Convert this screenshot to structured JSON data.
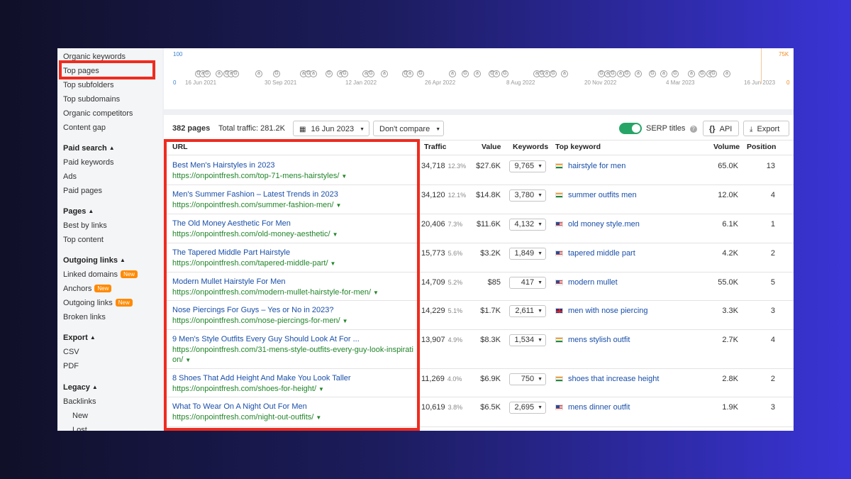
{
  "sidebar": {
    "items": [
      {
        "label": "Organic keywords"
      },
      {
        "label": "Top pages"
      },
      {
        "label": "Top subfolders"
      },
      {
        "label": "Top subdomains"
      },
      {
        "label": "Organic competitors"
      },
      {
        "label": "Content gap"
      }
    ],
    "paid_search": {
      "heading": "Paid search",
      "items": [
        "Paid keywords",
        "Ads",
        "Paid pages"
      ]
    },
    "pages": {
      "heading": "Pages",
      "items": [
        "Best by links",
        "Top content"
      ]
    },
    "outgoing_links": {
      "heading": "Outgoing links",
      "items": [
        "Linked domains",
        "Anchors",
        "Outgoing links",
        "Broken links"
      ],
      "new_badge": "New"
    },
    "export": {
      "heading": "Export",
      "items": [
        "CSV",
        "PDF"
      ]
    },
    "legacy": {
      "heading": "Legacy",
      "items": [
        "Backlinks",
        "New",
        "Lost"
      ]
    }
  },
  "timeline": {
    "left_top": "100",
    "left_bottom": "0",
    "right_top": "75K",
    "right_bottom": "0",
    "dates": [
      "16 Jun 2021",
      "30 Sep 2021",
      "12 Jan 2022",
      "26 Apr 2022",
      "8 Aug 2022",
      "20 Nov 2022",
      "4 Mar 2023",
      "16 Jun 2023"
    ],
    "marker_glyphs": [
      "G",
      "a"
    ]
  },
  "toolbar": {
    "pages_count": "382 pages",
    "total_traffic": "Total traffic: 281.2K",
    "date": "16 Jun 2023",
    "compare": "Don't compare",
    "serp_titles": "SERP titles",
    "api": "API",
    "export": "Export"
  },
  "table": {
    "headers": {
      "url": "URL",
      "traffic": "Traffic",
      "value": "Value",
      "keywords": "Keywords",
      "top_keyword": "Top keyword",
      "volume": "Volume",
      "position": "Position"
    },
    "rows": [
      {
        "title": "Best Men's Hairstyles in 2023",
        "url": "https://onpointfresh.com/top-71-mens-hairstyles/",
        "traffic": "34,718",
        "pct": "12.3%",
        "value": "$27.6K",
        "keywords": "9,765",
        "flag": "in",
        "top_keyword": "hairstyle for men",
        "volume": "65.0K",
        "position": "13"
      },
      {
        "title": "Men's Summer Fashion – Latest Trends in 2023",
        "url": "https://onpointfresh.com/summer-fashion-men/",
        "traffic": "34,120",
        "pct": "12.1%",
        "value": "$14.8K",
        "keywords": "3,780",
        "flag": "in",
        "top_keyword": "summer outfits men",
        "volume": "12.0K",
        "position": "4"
      },
      {
        "title": "The Old Money Aesthetic For Men",
        "url": "https://onpointfresh.com/old-money-aesthetic/",
        "traffic": "20,406",
        "pct": "7.3%",
        "value": "$11.6K",
        "keywords": "4,132",
        "flag": "us",
        "top_keyword": "old money style.men",
        "volume": "6.1K",
        "position": "1"
      },
      {
        "title": "The Tapered Middle Part Hairstyle",
        "url": "https://onpointfresh.com/tapered-middle-part/",
        "traffic": "15,773",
        "pct": "5.6%",
        "value": "$3.2K",
        "keywords": "1,849",
        "flag": "us",
        "top_keyword": "tapered middle part",
        "volume": "4.2K",
        "position": "2"
      },
      {
        "title": "Modern Mullet Hairstyle For Men",
        "url": "https://onpointfresh.com/modern-mullet-hairstyle-for-men/",
        "traffic": "14,709",
        "pct": "5.2%",
        "value": "$85",
        "keywords": "417",
        "flag": "us",
        "top_keyword": "modern mullet",
        "volume": "55.0K",
        "position": "5"
      },
      {
        "title": "Nose Piercings For Guys – Yes or No in 2023?",
        "url": "https://onpointfresh.com/nose-piercings-for-men/",
        "traffic": "14,229",
        "pct": "5.1%",
        "value": "$1.7K",
        "keywords": "2,611",
        "flag": "uk",
        "top_keyword": "men with nose piercing",
        "volume": "3.3K",
        "position": "3"
      },
      {
        "title": "9 Men's Style Outfits Every Guy Should Look At For ...",
        "url": "https://onpointfresh.com/31-mens-style-outfits-every-guy-look-inspiration/",
        "traffic": "13,907",
        "pct": "4.9%",
        "value": "$8.3K",
        "keywords": "1,534",
        "flag": "in",
        "top_keyword": "mens stylish outfit",
        "volume": "2.7K",
        "position": "4"
      },
      {
        "title": "8 Shoes That Add Height And Make You Look Taller",
        "url": "https://onpointfresh.com/shoes-for-height/",
        "traffic": "11,269",
        "pct": "4.0%",
        "value": "$6.9K",
        "keywords": "750",
        "flag": "in",
        "top_keyword": "shoes that increase height",
        "volume": "2.8K",
        "position": "2"
      },
      {
        "title": "What To Wear On A Night Out For Men",
        "url": "https://onpointfresh.com/night-out-outfits/",
        "traffic": "10,619",
        "pct": "3.8%",
        "value": "$6.5K",
        "keywords": "2,695",
        "flag": "us",
        "top_keyword": "mens dinner outfit",
        "volume": "1.9K",
        "position": "3"
      }
    ]
  },
  "colors": {
    "highlight": "#ef2b1f",
    "link": "#1a4fa8",
    "url_green": "#22852a",
    "toggle_on": "#27a567",
    "badge": "#ff8a00"
  }
}
